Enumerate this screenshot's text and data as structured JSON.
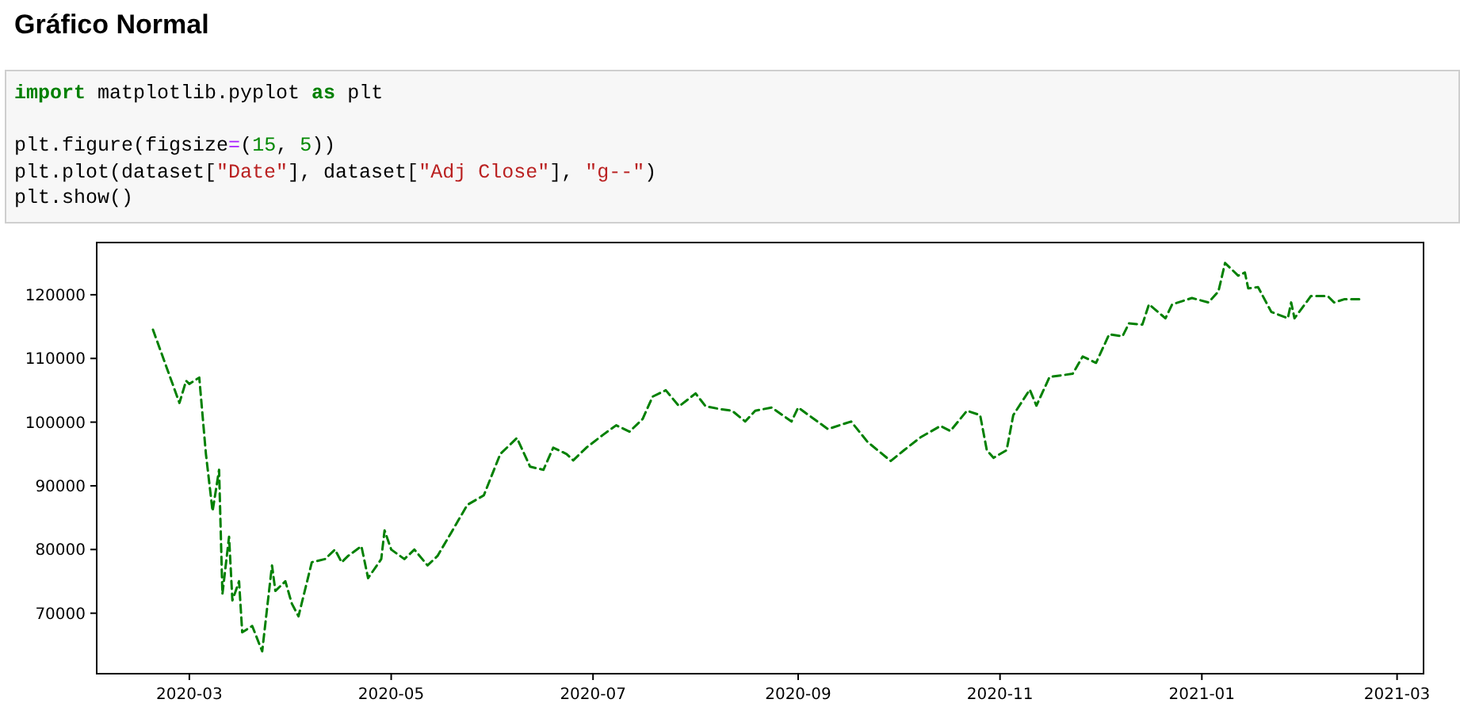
{
  "heading": "Gráfico Normal",
  "code_cell": {
    "blocks": [
      [
        [
          {
            "kind": "keyword",
            "text": "import"
          },
          {
            "kind": "plain",
            "text": " matplotlib.pyplot "
          },
          {
            "kind": "keyword",
            "text": "as"
          },
          {
            "kind": "plain",
            "text": " plt"
          }
        ]
      ],
      [
        [
          {
            "kind": "plain",
            "text": "plt.figure(figsize"
          },
          {
            "kind": "operator",
            "text": "="
          },
          {
            "kind": "plain",
            "text": "("
          },
          {
            "kind": "number",
            "text": "15"
          },
          {
            "kind": "plain",
            "text": ", "
          },
          {
            "kind": "number",
            "text": "5"
          },
          {
            "kind": "plain",
            "text": "))"
          }
        ],
        [
          {
            "kind": "plain",
            "text": "plt.plot(dataset["
          },
          {
            "kind": "string",
            "text": "\"Date\""
          },
          {
            "kind": "plain",
            "text": "], dataset["
          },
          {
            "kind": "string",
            "text": "\"Adj Close\""
          },
          {
            "kind": "plain",
            "text": "], "
          },
          {
            "kind": "string",
            "text": "\"g--\""
          },
          {
            "kind": "plain",
            "text": ")"
          }
        ],
        [
          {
            "kind": "plain",
            "text": "plt.show()"
          }
        ]
      ]
    ]
  },
  "output": {
    "chart_data": {
      "type": "line",
      "x": [
        "2020-02-19",
        "2020-02-27",
        "2020-02-29",
        "2020-03-01",
        "2020-03-04",
        "2020-03-06",
        "2020-03-08",
        "2020-03-10",
        "2020-03-11",
        "2020-03-13",
        "2020-03-14",
        "2020-03-16",
        "2020-03-17",
        "2020-03-20",
        "2020-03-23",
        "2020-03-25",
        "2020-03-26",
        "2020-03-27",
        "2020-03-30",
        "2020-04-01",
        "2020-04-03",
        "2020-04-07",
        "2020-04-11",
        "2020-04-14",
        "2020-04-16",
        "2020-04-18",
        "2020-04-22",
        "2020-04-24",
        "2020-04-28",
        "2020-04-29",
        "2020-05-01",
        "2020-05-05",
        "2020-05-08",
        "2020-05-12",
        "2020-05-15",
        "2020-05-19",
        "2020-05-24",
        "2020-05-29",
        "2020-06-03",
        "2020-06-08",
        "2020-06-12",
        "2020-06-16",
        "2020-06-19",
        "2020-06-23",
        "2020-06-25",
        "2020-06-29",
        "2020-07-04",
        "2020-07-08",
        "2020-07-12",
        "2020-07-16",
        "2020-07-19",
        "2020-07-23",
        "2020-07-27",
        "2020-08-01",
        "2020-08-04",
        "2020-08-09",
        "2020-08-12",
        "2020-08-16",
        "2020-08-19",
        "2020-08-24",
        "2020-08-30",
        "2020-09-01",
        "2020-09-10",
        "2020-09-17",
        "2020-09-22",
        "2020-09-29",
        "2020-10-03",
        "2020-10-08",
        "2020-10-14",
        "2020-10-17",
        "2020-10-22",
        "2020-10-26",
        "2020-10-28",
        "2020-10-30",
        "2020-11-03",
        "2020-11-05",
        "2020-11-10",
        "2020-11-12",
        "2020-11-16",
        "2020-11-23",
        "2020-11-26",
        "2020-11-30",
        "2020-12-04",
        "2020-12-08",
        "2020-12-10",
        "2020-12-14",
        "2020-12-16",
        "2020-12-21",
        "2020-12-23",
        "2020-12-29",
        "2021-01-03",
        "2021-01-06",
        "2021-01-08",
        "2021-01-12",
        "2021-01-14",
        "2021-01-15",
        "2021-01-18",
        "2021-01-22",
        "2021-01-27",
        "2021-01-28",
        "2021-01-29",
        "2021-02-03",
        "2021-02-08",
        "2021-02-10",
        "2021-02-13",
        "2021-02-18"
      ],
      "series": [
        {
          "color": "#008000",
          "line_style": "dashed",
          "values": [
            114500,
            103000,
            106500,
            106000,
            107000,
            95000,
            86000,
            92500,
            73000,
            82000,
            72000,
            75000,
            67000,
            68000,
            64000,
            73000,
            77500,
            73500,
            75000,
            71500,
            69500,
            78000,
            78500,
            80000,
            78000,
            79000,
            80500,
            75500,
            78500,
            83000,
            80000,
            78500,
            80000,
            77500,
            79000,
            82500,
            87000,
            88500,
            95000,
            97500,
            93000,
            92500,
            96000,
            95000,
            94000,
            96000,
            98000,
            99500,
            98500,
            100500,
            104000,
            105000,
            102500,
            104500,
            102500,
            102000,
            101800,
            100100,
            101800,
            102300,
            100100,
            102300,
            98900,
            100100,
            96900,
            93900,
            95600,
            97600,
            99400,
            98600,
            101800,
            101100,
            95600,
            94400,
            95600,
            101100,
            105100,
            102600,
            107100,
            107600,
            110300,
            109300,
            113800,
            113500,
            115500,
            115300,
            118500,
            116300,
            118500,
            119500,
            118800,
            120500,
            125000,
            123000,
            123500,
            121000,
            121200,
            117300,
            116300,
            118800,
            116300,
            119800,
            119800,
            118800,
            119300,
            119300
          ]
        }
      ],
      "xlim": [
        "2020-02-02",
        "2021-03-09"
      ],
      "ylim": [
        60500,
        128200
      ],
      "xticks": [
        {
          "value": "2020-03-01",
          "label": "2020-03"
        },
        {
          "value": "2020-05-01",
          "label": "2020-05"
        },
        {
          "value": "2020-07-01",
          "label": "2020-07"
        },
        {
          "value": "2020-09-01",
          "label": "2020-09"
        },
        {
          "value": "2020-11-01",
          "label": "2020-11"
        },
        {
          "value": "2021-01-01",
          "label": "2021-01"
        },
        {
          "value": "2021-03-01",
          "label": "2021-03"
        }
      ],
      "yticks": [
        70000,
        80000,
        90000,
        100000,
        110000,
        120000
      ]
    }
  }
}
